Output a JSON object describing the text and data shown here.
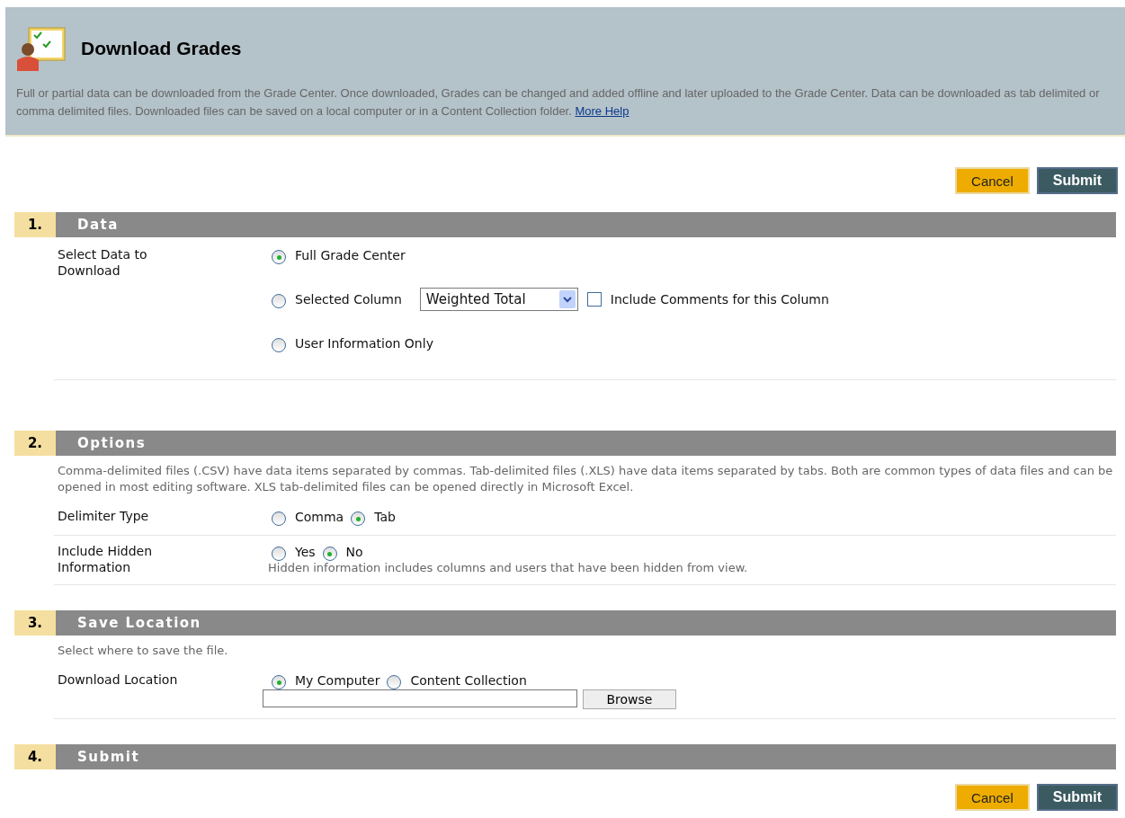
{
  "header": {
    "title": "Download Grades",
    "description": "Full or partial data can be downloaded from the Grade Center. Once downloaded, Grades can be changed and added offline and later uploaded to the Grade Center. Data can be downloaded as tab delimited or comma delimited files. Downloaded files can be saved on a local computer or in a Content Collection folder.",
    "help_link": "More Help"
  },
  "top_buttons": [
    {
      "label": "Cancel",
      "kind": "cancel"
    },
    {
      "label": "Submit",
      "kind": "submit"
    }
  ],
  "sections": [
    {
      "number": "1.",
      "title": "Data",
      "rows": [
        {
          "label": "Select Data to Download",
          "kind": "stack",
          "options": [
            {
              "label": "Full Grade Center",
              "selected": true
            },
            {
              "label": "Selected Column",
              "selected": false,
              "select": {
                "value": "Weighted Total"
              },
              "checkbox": {
                "label": "Include Comments for this Column",
                "checked": false
              }
            },
            {
              "label": "User Information Only",
              "selected": false
            }
          ]
        }
      ]
    },
    {
      "number": "2.",
      "title": "Options",
      "description": "Comma-delimited files (.CSV) have data items separated by commas. Tab-delimited files (.XLS) have data items separated by tabs. Both are common types of data files and can be opened in most editing software. XLS tab-delimited files can be opened directly in Microsoft Excel.",
      "rows": [
        {
          "label": "Delimiter Type",
          "kind": "inline",
          "options": [
            {
              "label": "Comma",
              "selected": false
            },
            {
              "label": "Tab",
              "selected": true
            }
          ]
        },
        {
          "label": "Include Hidden Information",
          "kind": "inline",
          "options": [
            {
              "label": "Yes",
              "selected": false
            },
            {
              "label": "No",
              "selected": true
            }
          ],
          "note": "Hidden information includes columns and users that have been hidden from view."
        }
      ]
    },
    {
      "number": "3.",
      "title": "Save Location",
      "description": "Select where to save the file.",
      "rows": [
        {
          "label": "Download Location",
          "kind": "inline",
          "options": [
            {
              "label": "My Computer",
              "selected": true
            },
            {
              "label": "Content Collection",
              "selected": false
            }
          ],
          "file_button": "Browse"
        }
      ]
    },
    {
      "number": "4.",
      "title": "Submit"
    }
  ],
  "bottom_buttons": [
    {
      "label": "Cancel",
      "kind": "cancel"
    },
    {
      "label": "Submit",
      "kind": "submit"
    }
  ]
}
